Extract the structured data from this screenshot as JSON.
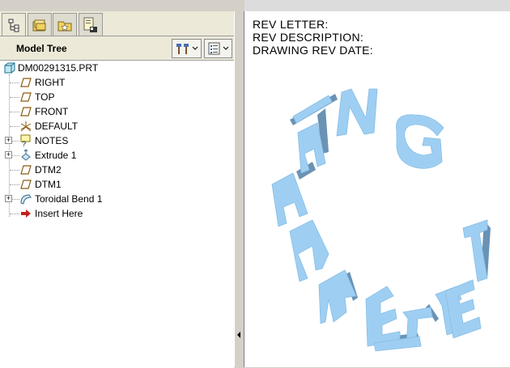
{
  "model_tree": {
    "header_title": "Model Tree",
    "tabs": [
      "model-tree-tab",
      "layers-tab",
      "favorites-tab",
      "feature-list-tab"
    ],
    "root": {
      "label": "DM00291315.PRT",
      "icon": "part-icon"
    },
    "items": [
      {
        "label": "RIGHT",
        "icon": "datum-plane-icon"
      },
      {
        "label": "TOP",
        "icon": "datum-plane-icon"
      },
      {
        "label": "FRONT",
        "icon": "datum-plane-icon"
      },
      {
        "label": "DEFAULT",
        "icon": "coordinate-system-icon"
      },
      {
        "label": "NOTES",
        "icon": "notes-icon"
      },
      {
        "label": "Extrude 1",
        "icon": "extrude-icon"
      },
      {
        "label": "DTM2",
        "icon": "datum-plane-icon"
      },
      {
        "label": "DTM1",
        "icon": "datum-plane-icon"
      },
      {
        "label": "Toroidal Bend 1",
        "icon": "toroidal-bend-icon"
      },
      {
        "label": "Insert Here",
        "icon": "insert-arrow-icon"
      }
    ]
  },
  "graphics": {
    "notes": [
      "REV LETTER:",
      "REV DESCRIPTION:",
      "DRAWING REV DATE:"
    ],
    "text_color": "#9ecff2",
    "shade_color": "#5a87ad"
  }
}
